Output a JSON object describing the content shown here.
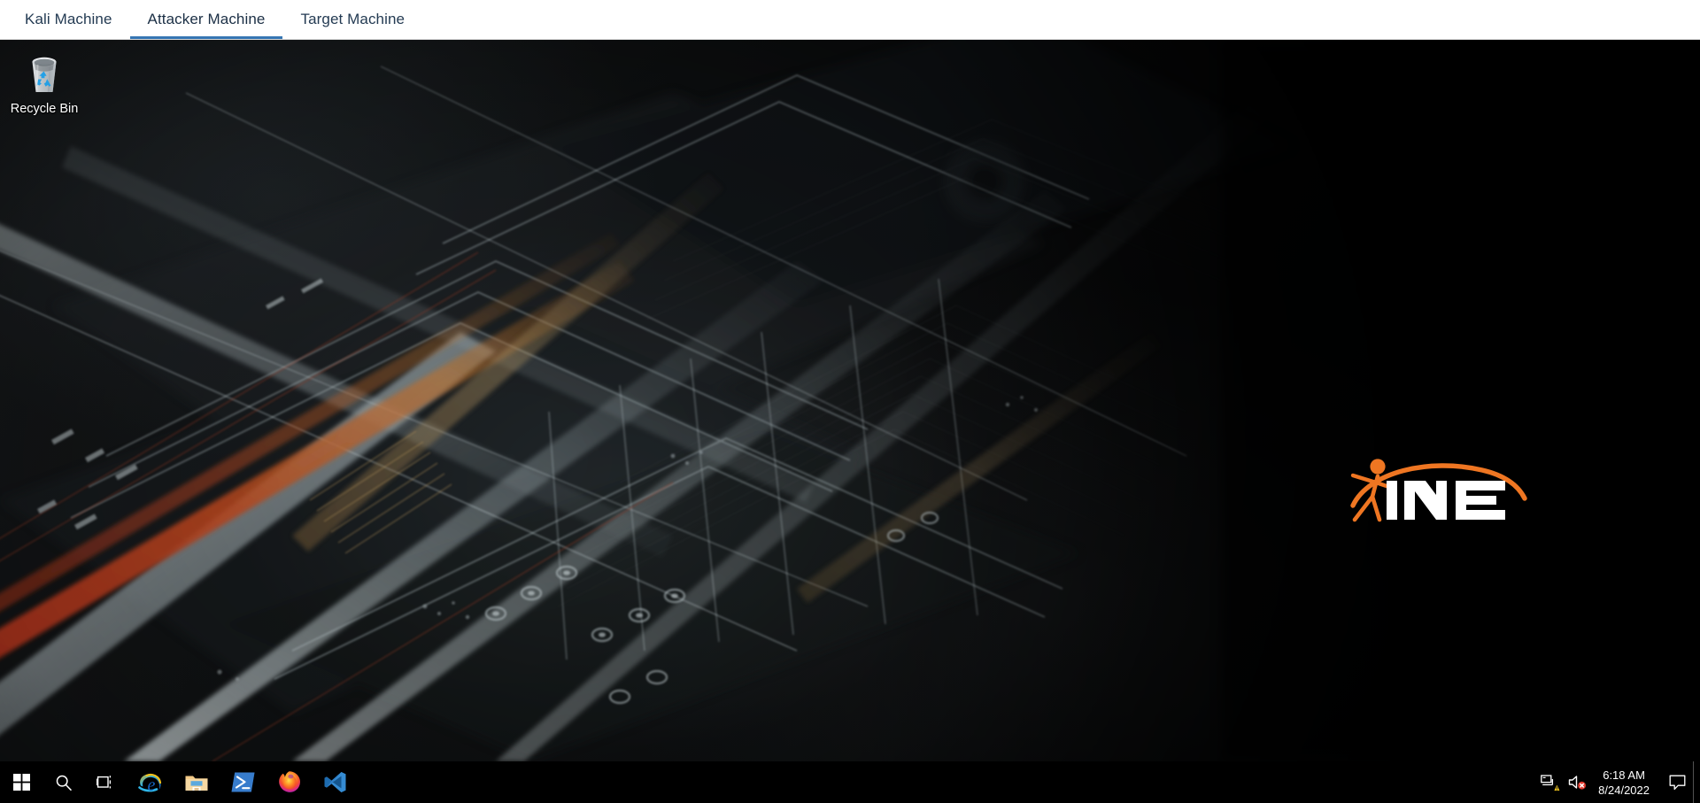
{
  "tabs": [
    {
      "label": "Kali Machine",
      "active": false
    },
    {
      "label": "Attacker Machine",
      "active": true
    },
    {
      "label": "Target Machine",
      "active": false
    }
  ],
  "desktop": {
    "icons": [
      {
        "name": "recycle-bin",
        "label": "Recycle Bin"
      }
    ],
    "watermark": {
      "text": "INE",
      "accent_color": "#ef7622",
      "letters_color": "#ffffff"
    },
    "wallpaper": {
      "description": "dark circuit board",
      "base_color": "#0a0b0c"
    }
  },
  "taskbar": {
    "background_color": "#000000",
    "buttons": [
      {
        "name": "start-button",
        "tooltip": "Start"
      },
      {
        "name": "search-icon",
        "tooltip": "Search"
      },
      {
        "name": "task-view-icon",
        "tooltip": "Task View"
      }
    ],
    "apps": [
      {
        "name": "internet-explorer-icon",
        "tooltip": "Internet Explorer"
      },
      {
        "name": "file-explorer-icon",
        "tooltip": "File Explorer"
      },
      {
        "name": "powershell-icon",
        "tooltip": "Windows PowerShell"
      },
      {
        "name": "firefox-icon",
        "tooltip": "Firefox"
      },
      {
        "name": "vscode-icon",
        "tooltip": "Visual Studio Code"
      }
    ],
    "tray": [
      {
        "name": "network-warning-icon",
        "tooltip": "No Internet access"
      },
      {
        "name": "volume-muted-icon",
        "tooltip": "Volume muted"
      }
    ],
    "clock": {
      "time": "6:18 AM",
      "date": "8/24/2022"
    },
    "notification": {
      "name": "action-center-icon",
      "tooltip": "Notifications"
    }
  }
}
